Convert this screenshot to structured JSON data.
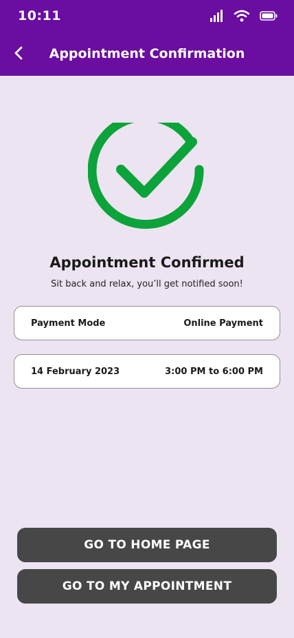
{
  "status_bar": {
    "time": "10:11",
    "icons": [
      "signal-icon",
      "wifi-icon",
      "battery-icon"
    ]
  },
  "header": {
    "title": "Appointment Confirmation",
    "back_icon": "chevron-left-icon"
  },
  "confirmation": {
    "icon": "check-circle-icon",
    "title": "Appointment Confirmed",
    "subtitle": "Sit back and relax, you’ll get notified soon!"
  },
  "details": {
    "payment_label": "Payment Mode",
    "payment_value": "Online Payment",
    "date": "14 February 2023",
    "time_slot": "3:00 PM to 6:00 PM"
  },
  "actions": {
    "home_label": "GO TO HOME PAGE",
    "appointment_label": "GO TO MY APPOINTMENT"
  },
  "colors": {
    "header_bg": "#6A0DA0",
    "page_bg": "#EDE4F2",
    "success_green": "#0CA33A",
    "button_bg": "#474747"
  }
}
